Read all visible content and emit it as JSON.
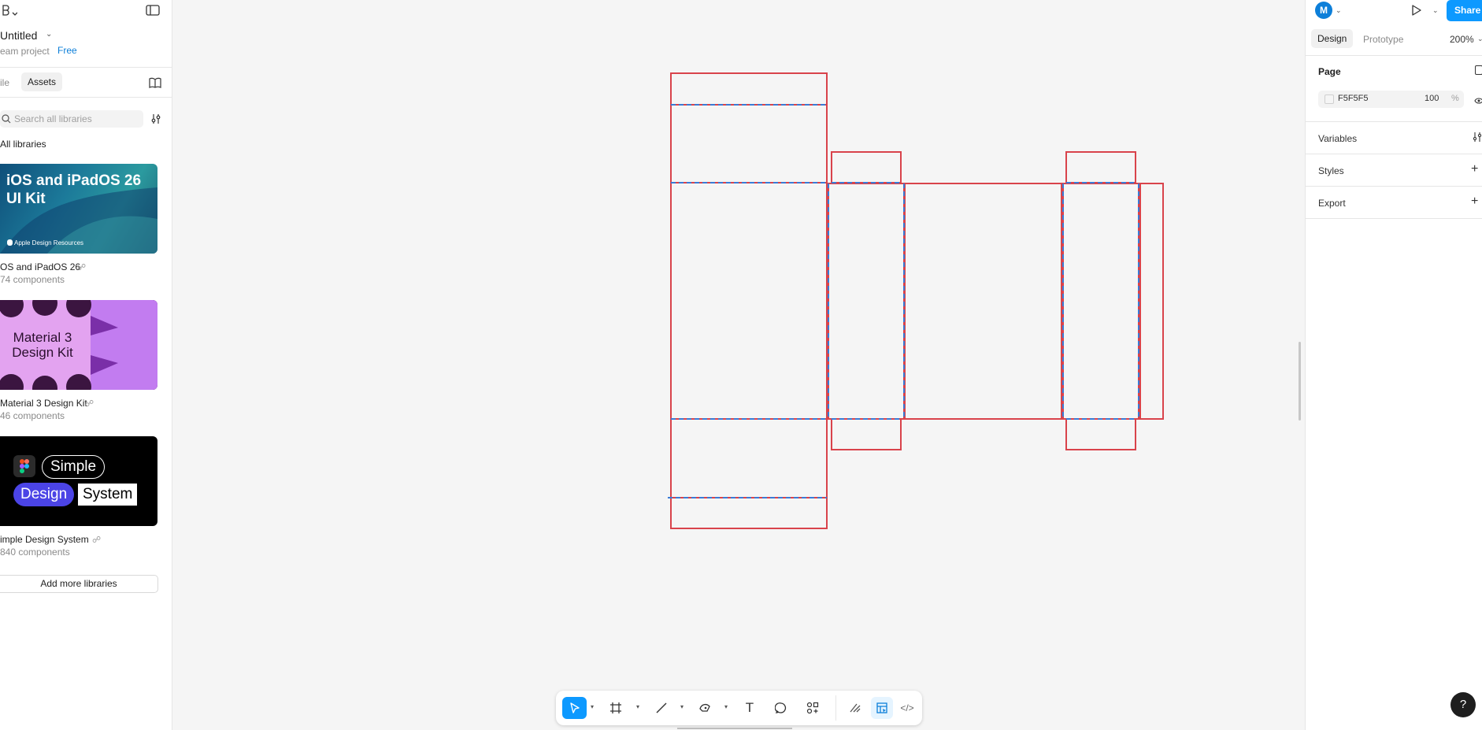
{
  "file": {
    "title": "Untitled",
    "team": "eam project",
    "plan_badge": "Free"
  },
  "left_panel": {
    "tab_file": "ile",
    "tab_assets": "Assets",
    "search_placeholder": "Search all libraries",
    "all_libraries_label": "All libraries",
    "libraries": [
      {
        "thumb_title": "iOS and iPadOS 26 UI Kit",
        "thumb_caption": "Apple Design Resources",
        "name": "OS and iPadOS 26",
        "count": "74 components"
      },
      {
        "thumb_title": "Material 3 Design Kit",
        "name": "Material 3 Design Kit",
        "count": "46 components"
      },
      {
        "thumb_words": [
          "Simple",
          "Design",
          "System"
        ],
        "name": "imple Design System",
        "count": "840 components"
      }
    ],
    "add_more_label": "Add more libraries"
  },
  "right_panel": {
    "avatar_initial": "M",
    "share_label": "Share",
    "tab_design": "Design",
    "tab_prototype": "Prototype",
    "zoom": "200%",
    "page_label": "Page",
    "page_fill_hex": "F5F5F5",
    "page_fill_opacity": "100",
    "page_fill_percent": "%",
    "variables_label": "Variables",
    "styles_label": "Styles",
    "export_label": "Export"
  },
  "toolbar": {
    "tools": [
      "move-tool",
      "frame-tool",
      "line-tool",
      "pen-tool",
      "text-tool",
      "comment-tool",
      "actions-tool",
      "draw-mode",
      "design-mode",
      "dev-mode"
    ]
  },
  "help_label": "?",
  "colors": {
    "accent": "#0d99ff",
    "cut_line": "#d9434b",
    "fold_line": "#3a7bd5",
    "canvas_bg": "#f5f5f5"
  }
}
